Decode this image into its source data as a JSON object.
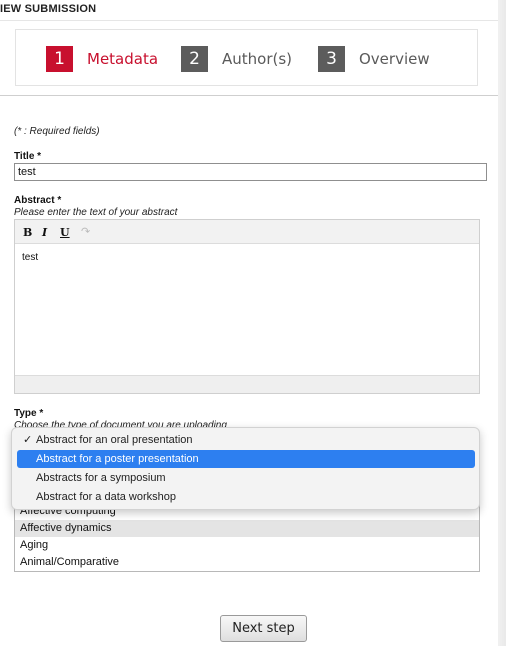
{
  "header": {
    "title": "IEW SUBMISSION"
  },
  "steps": [
    {
      "number": "1",
      "label": "Metadata",
      "state": "active"
    },
    {
      "number": "2",
      "label": "Author(s)",
      "state": "inactive"
    },
    {
      "number": "3",
      "label": "Overview",
      "state": "inactive"
    }
  ],
  "form": {
    "required_note": "(* : Required fields)",
    "title_field": {
      "label": "Title *",
      "value": "test"
    },
    "abstract_field": {
      "label": "Abstract *",
      "help": "Please enter the text of your abstract",
      "toolbar": {
        "bold": "B",
        "italic": "I",
        "underline": "U",
        "redo": "↷"
      },
      "content": "test"
    },
    "type_field": {
      "label": "Type *",
      "help": "Choose the type of document you are uploading",
      "options": [
        {
          "label": "Abstract for an oral presentation",
          "checked": true,
          "highlighted": false
        },
        {
          "label": "Abstract for a poster presentation",
          "checked": false,
          "highlighted": true
        },
        {
          "label": "Abstracts for a symposium",
          "checked": false,
          "highlighted": false
        },
        {
          "label": "Abstract for a data workshop",
          "checked": false,
          "highlighted": false
        }
      ]
    },
    "topics_list": {
      "items": [
        "Affective computing",
        "Affective dynamics",
        "Aging",
        "Animal/Comparative"
      ]
    }
  },
  "actions": {
    "next_label": "Next step"
  },
  "colors": {
    "accent": "#c8102e",
    "inactive_step": "#5c5c5c",
    "selection": "#2d7ff0"
  }
}
